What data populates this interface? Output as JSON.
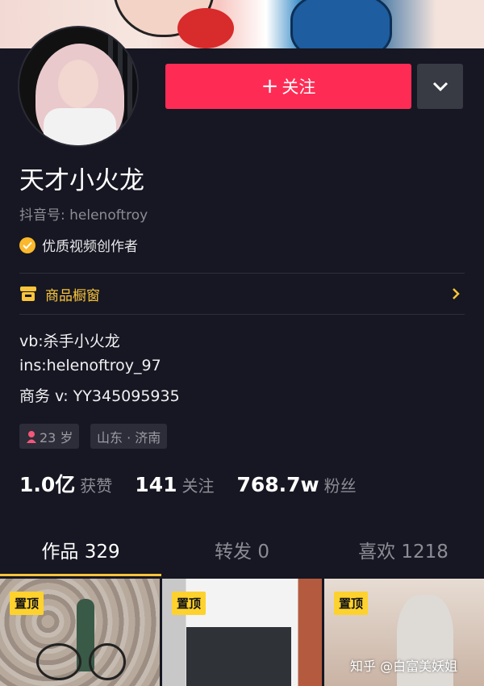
{
  "profile": {
    "follow_label": "关注",
    "name": "天才小火龙",
    "douyin_id": "抖音号: helenoftroy",
    "verified_label": "优质视频创作者"
  },
  "shop": {
    "label": "商品橱窗"
  },
  "bio": {
    "line1": "vb:杀手小火龙",
    "line2": "ins:helenoftroy_97",
    "line3": "商务 v: YY345095935"
  },
  "tags": {
    "age": "23 岁",
    "location": "山东 · 济南"
  },
  "stats": {
    "likes_value": "1.0亿",
    "likes_label": "获赞",
    "following_value": "141",
    "following_label": "关注",
    "followers_value": "768.7w",
    "followers_label": "粉丝"
  },
  "tabs": {
    "works": "作品 329",
    "reposts": "转发 0",
    "likes": "喜欢 1218"
  },
  "grid": {
    "pin_label": "置顶"
  },
  "watermark": "知乎 @白富美妖姐",
  "colors": {
    "accent": "#fe2c55",
    "tab_indicator": "#fac33a",
    "badge": "#fbb82c",
    "background": "#161722"
  }
}
